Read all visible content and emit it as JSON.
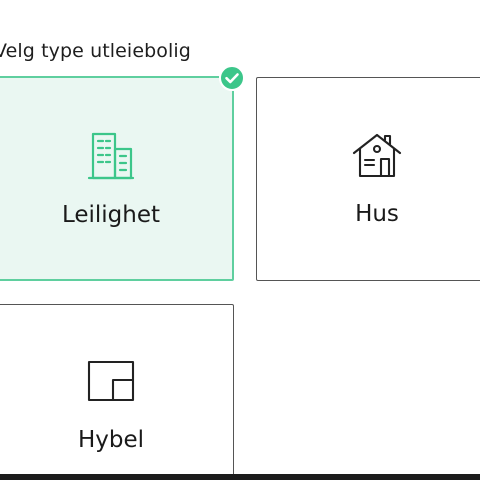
{
  "heading": "Velg type utleiebolig",
  "options": [
    {
      "label": "Leilighet",
      "icon": "apartment-building-icon",
      "selected": true
    },
    {
      "label": "Hus",
      "icon": "house-icon",
      "selected": false
    },
    {
      "label": "Hybel",
      "icon": "room-floorplan-icon",
      "selected": false
    }
  ],
  "selected_badge_icon": "checkmark-icon",
  "colors": {
    "accent": "#3cc68a",
    "accent_bg": "#eaf7f2",
    "card_border": "#555555",
    "text": "#1a1a1a"
  }
}
